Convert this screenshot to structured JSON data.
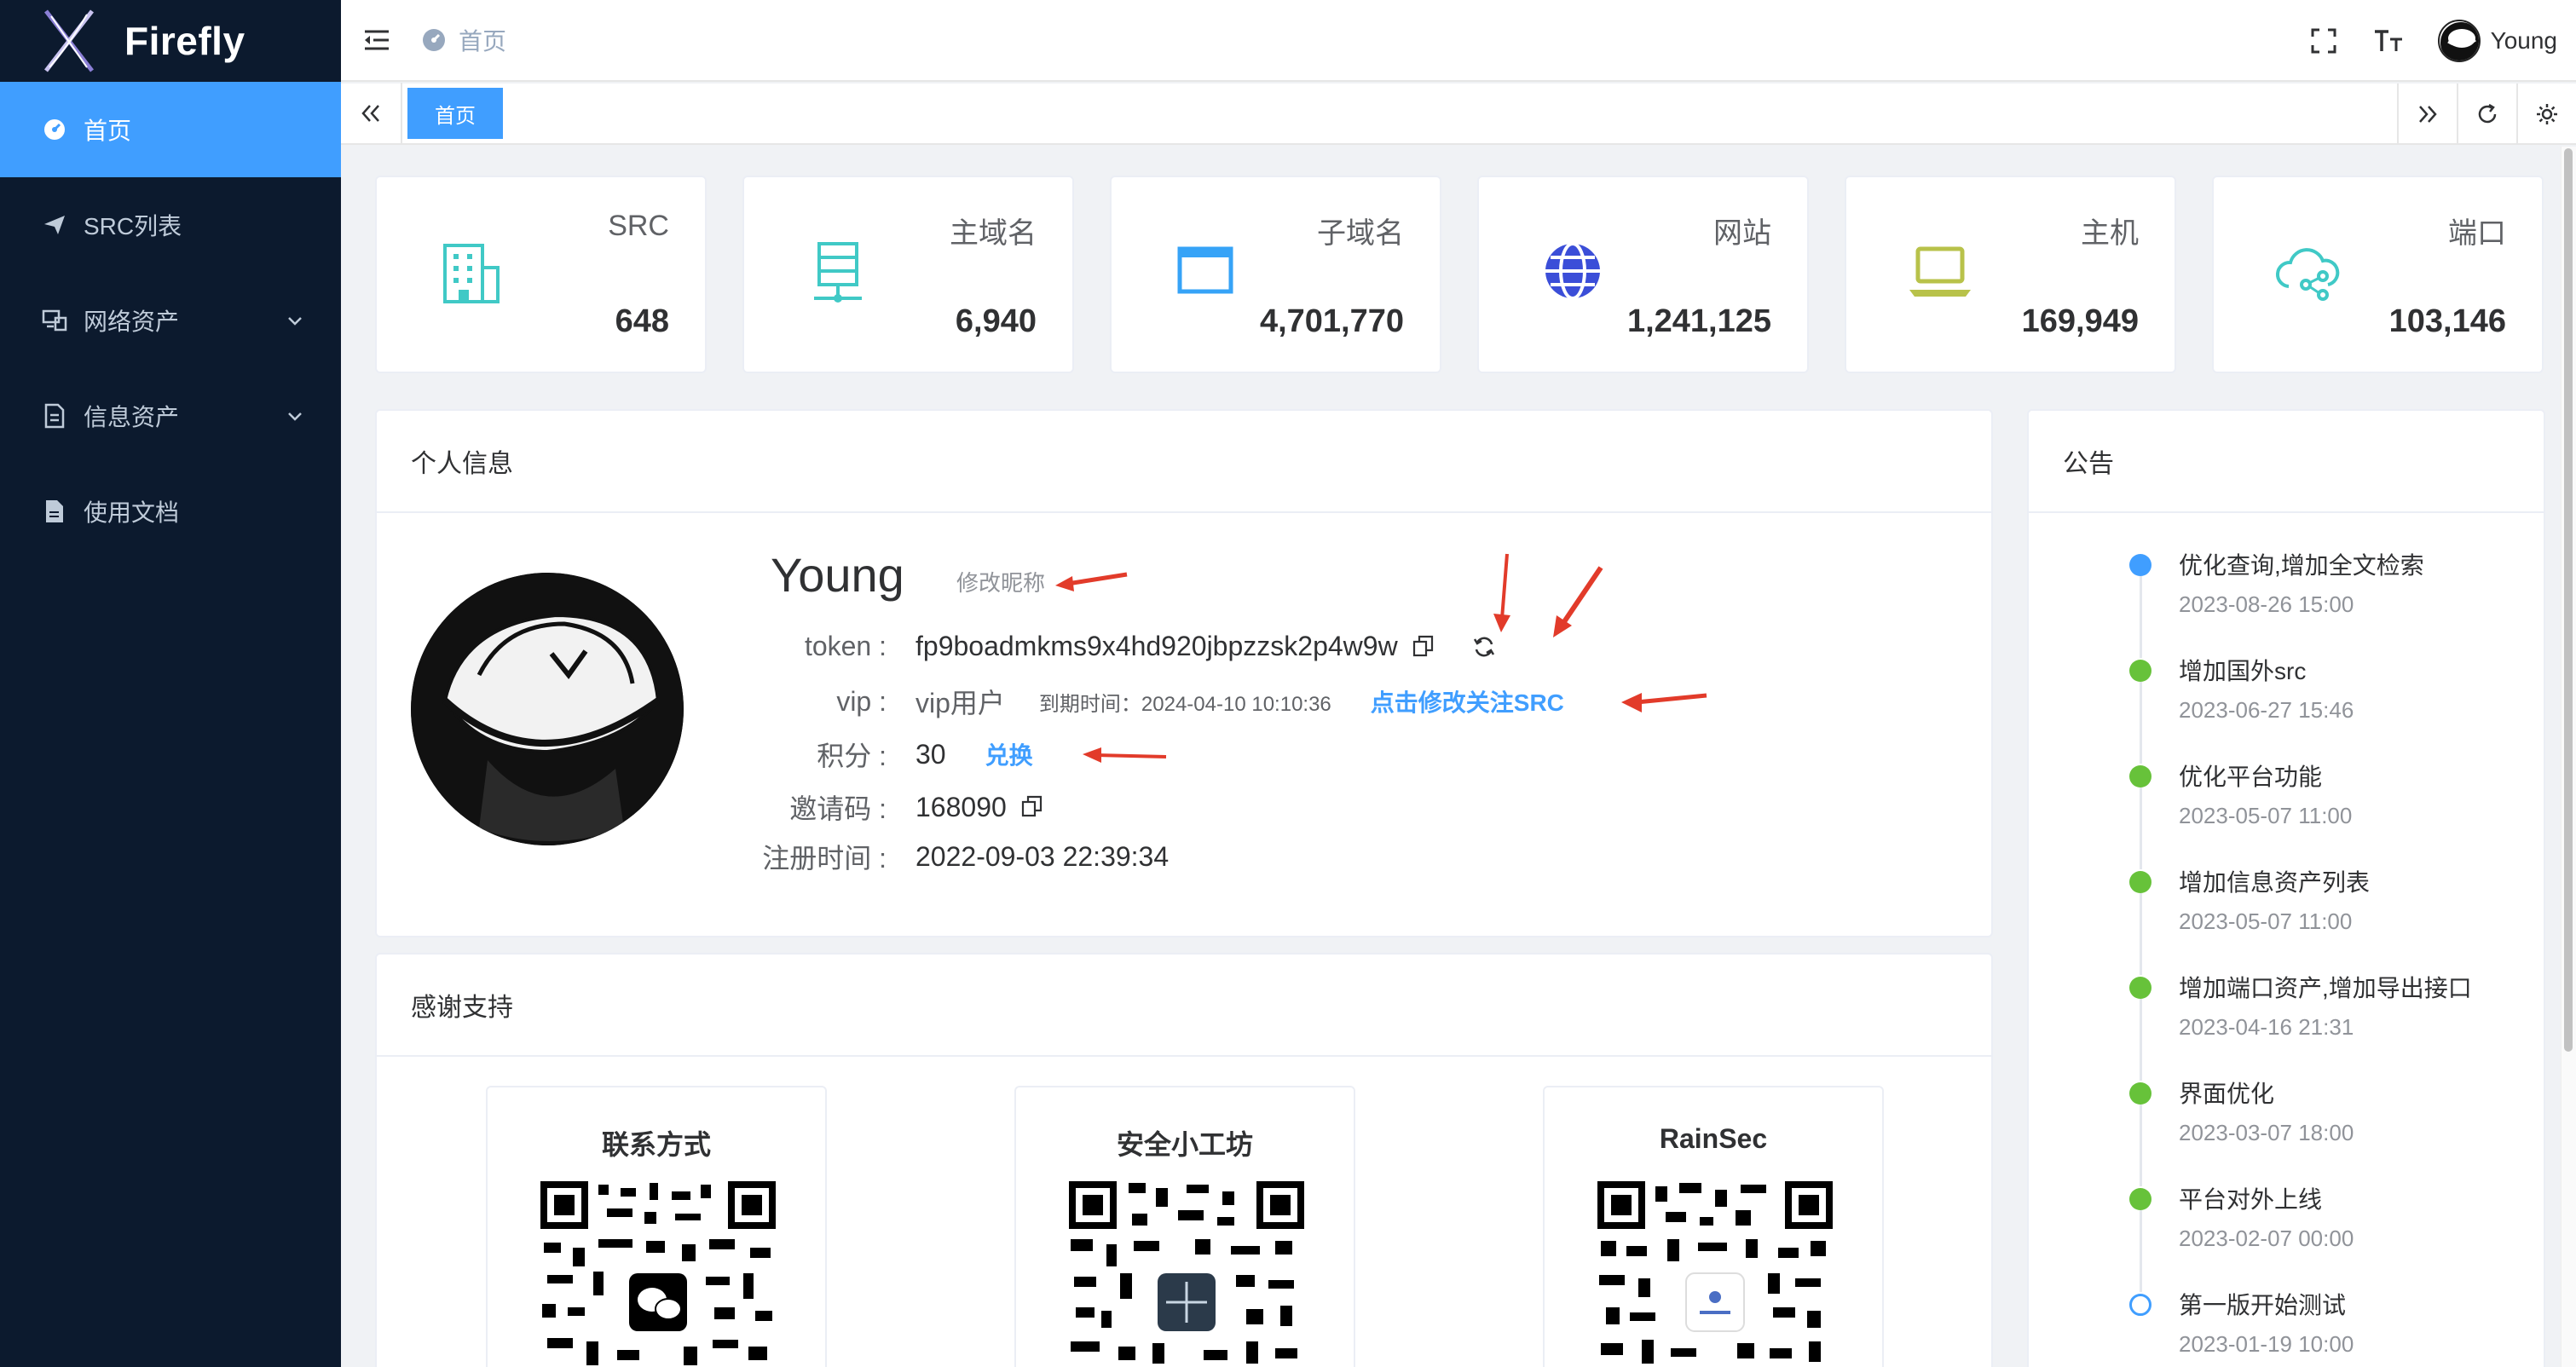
{
  "app": {
    "name": "Firefly"
  },
  "sidebar": {
    "items": [
      {
        "label": "首页",
        "icon": "dashboard-icon",
        "active": true
      },
      {
        "label": "SRC列表",
        "icon": "paper-plane-icon"
      },
      {
        "label": "网络资产",
        "icon": "network-asset-icon",
        "expandable": true
      },
      {
        "label": "信息资产",
        "icon": "document-list-icon",
        "expandable": true
      },
      {
        "label": "使用文档",
        "icon": "document-icon"
      }
    ]
  },
  "header": {
    "breadcrumb": "首页",
    "username": "Young"
  },
  "tags": {
    "active": "首页"
  },
  "stats": [
    {
      "label": "SRC",
      "value": "648",
      "icon": "building-icon",
      "color": "#40c9c6"
    },
    {
      "label": "主域名",
      "value": "6,940",
      "icon": "server-icon",
      "color": "#40c9c6"
    },
    {
      "label": "子域名",
      "value": "4,701,770",
      "icon": "window-icon",
      "color": "#36a3f7"
    },
    {
      "label": "网站",
      "value": "1,241,125",
      "icon": "globe-icon",
      "color": "#3b4ed8"
    },
    {
      "label": "主机",
      "value": "169,949",
      "icon": "laptop-icon",
      "color": "#b8c24a"
    },
    {
      "label": "端口",
      "value": "103,146",
      "icon": "cloud-share-icon",
      "color": "#40c9c6"
    }
  ],
  "profile": {
    "title": "个人信息",
    "name": "Young",
    "edit_nickname": "修改昵称",
    "token_label": "token :",
    "token": "fp9boadmkms9x4hd920jbpzzsk2p4w9w",
    "vip_label": "vip :",
    "vip": "vip用户",
    "vip_expire": "到期时间：2024-04-10 10:10:36",
    "vip_link": "点击修改关注SRC",
    "points_label": "积分 :",
    "points": "30",
    "redeem": "兑换",
    "invite_label": "邀请码 :",
    "invite": "168090",
    "register_label": "注册时间 :",
    "register": "2022-09-03 22:39:34"
  },
  "support": {
    "title": "感谢支持",
    "cards": [
      {
        "title": "联系方式",
        "logo": "wechat-icon"
      },
      {
        "title": "安全小工坊",
        "logo": "star-logo-icon"
      },
      {
        "title": "RainSec",
        "logo": "rainsec-logo-icon"
      }
    ]
  },
  "notice": {
    "title": "公告",
    "items": [
      {
        "title": "优化查询,增加全文检索",
        "time": "2023-08-26 15:00",
        "color": "#409eff",
        "filled": true
      },
      {
        "title": "增加国外src",
        "time": "2023-06-27 15:46",
        "color": "#67c23a",
        "filled": true
      },
      {
        "title": "优化平台功能",
        "time": "2023-05-07 11:00",
        "color": "#67c23a",
        "filled": true
      },
      {
        "title": "增加信息资产列表",
        "time": "2023-05-07 11:00",
        "color": "#67c23a",
        "filled": true
      },
      {
        "title": "增加端口资产,增加导出接口",
        "time": "2023-04-16 21:31",
        "color": "#67c23a",
        "filled": true
      },
      {
        "title": "界面优化",
        "time": "2023-03-07 18:00",
        "color": "#67c23a",
        "filled": true
      },
      {
        "title": "平台对外上线",
        "time": "2023-02-07 00:00",
        "color": "#67c23a",
        "filled": true
      },
      {
        "title": "第一版开始测试",
        "time": "2023-01-19 10:00",
        "color": "#409eff",
        "filled": false
      }
    ]
  }
}
